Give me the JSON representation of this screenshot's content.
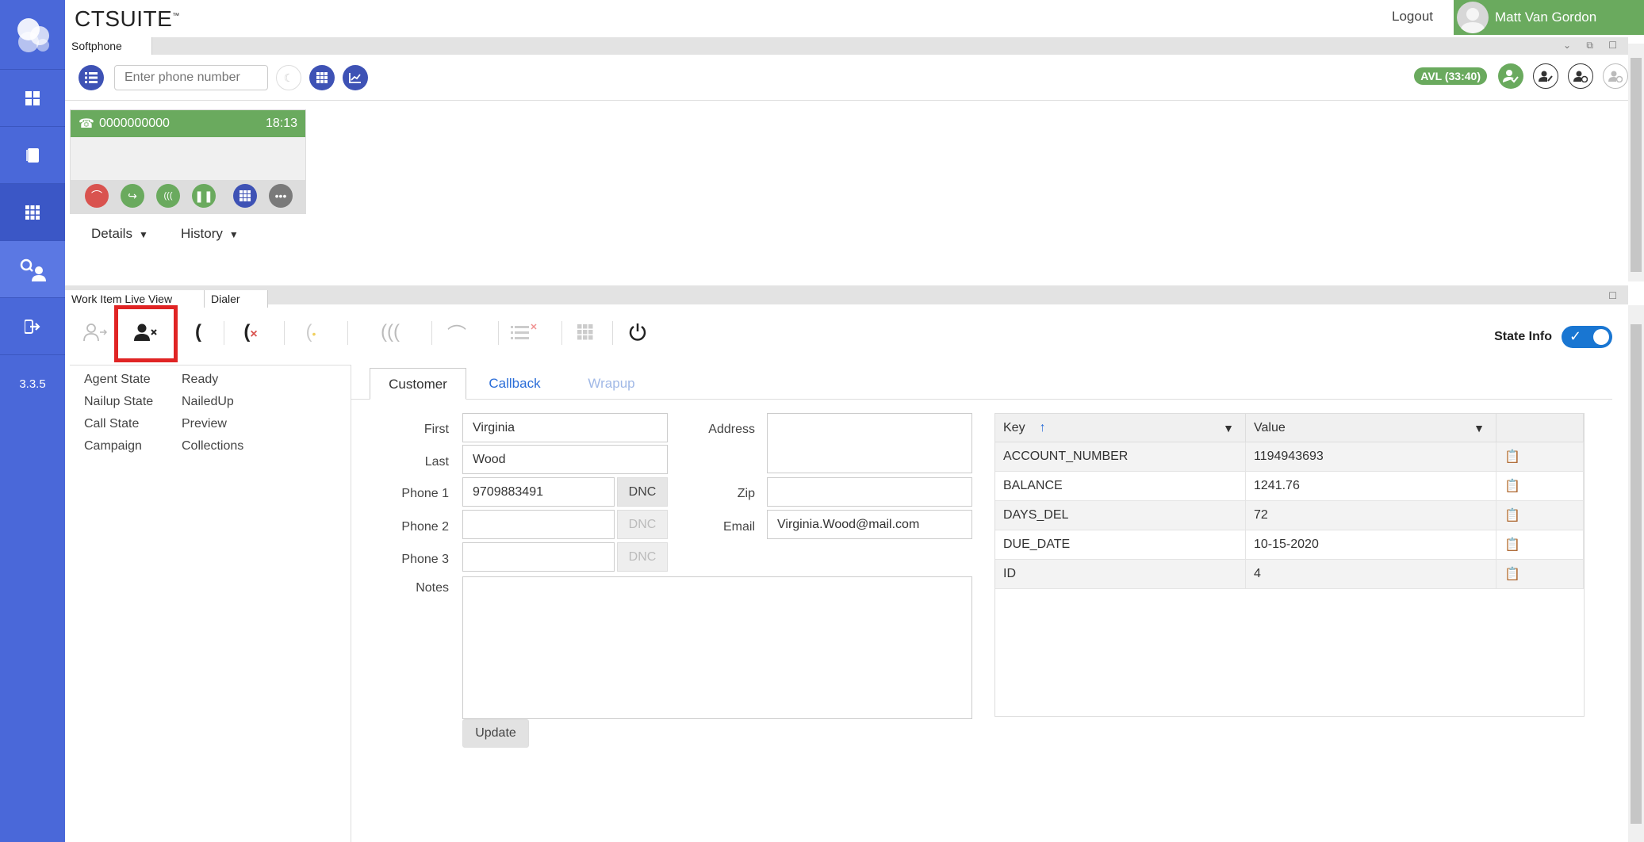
{
  "app": {
    "brand": "CTSUITE",
    "brand_mark": "™",
    "version": "3.3.5",
    "logout_label": "Logout",
    "user_name": "Matt Van Gordon"
  },
  "nav": {
    "items": [
      {
        "name": "dashboard-icon"
      },
      {
        "name": "book-icon"
      },
      {
        "name": "apps-grid-icon"
      },
      {
        "name": "agent-search-icon"
      },
      {
        "name": "sign-out-icon"
      }
    ]
  },
  "softphone": {
    "tab_label": "Softphone",
    "phone_placeholder": "Enter phone number",
    "avl_badge": "AVL (33:40)",
    "call": {
      "number": "0000000000",
      "time": "18:13"
    },
    "details_label": "Details",
    "history_label": "History"
  },
  "lower_tabs": {
    "tab1": "Work Item Live View",
    "tab2": "Dialer"
  },
  "dialer": {
    "state_info_label": "State Info",
    "state_info_on": true,
    "info": [
      {
        "key": "Agent State",
        "value": "Ready"
      },
      {
        "key": "Nailup State",
        "value": "NailedUp"
      },
      {
        "key": "Call State",
        "value": "Preview"
      },
      {
        "key": "Campaign",
        "value": "Collections"
      }
    ]
  },
  "form": {
    "tabs": {
      "customer": "Customer",
      "callback": "Callback",
      "wrapup": "Wrapup"
    },
    "labels": {
      "first": "First",
      "last": "Last",
      "phone1": "Phone 1",
      "phone2": "Phone 2",
      "phone3": "Phone 3",
      "notes": "Notes",
      "address": "Address",
      "zip": "Zip",
      "email": "Email",
      "dnc": "DNC",
      "update": "Update"
    },
    "values": {
      "first": "Virginia",
      "last": "Wood",
      "phone1": "9709883491",
      "phone2": "",
      "phone3": "",
      "address": "",
      "zip": "",
      "email": "Virginia.Wood@mail.com",
      "notes": ""
    }
  },
  "table": {
    "col_key": "Key",
    "col_value": "Value",
    "rows": [
      {
        "key": "ACCOUNT_NUMBER",
        "value": "1194943693"
      },
      {
        "key": "BALANCE",
        "value": "1241.76"
      },
      {
        "key": "DAYS_DEL",
        "value": "72"
      },
      {
        "key": "DUE_DATE",
        "value": "10-15-2020"
      },
      {
        "key": "ID",
        "value": "4"
      }
    ]
  },
  "colors": {
    "nav_bg": "#4a68d9",
    "accent_green": "#6aaa5e",
    "accent_blue": "#3e52b5",
    "highlight_red": "#e02424"
  }
}
